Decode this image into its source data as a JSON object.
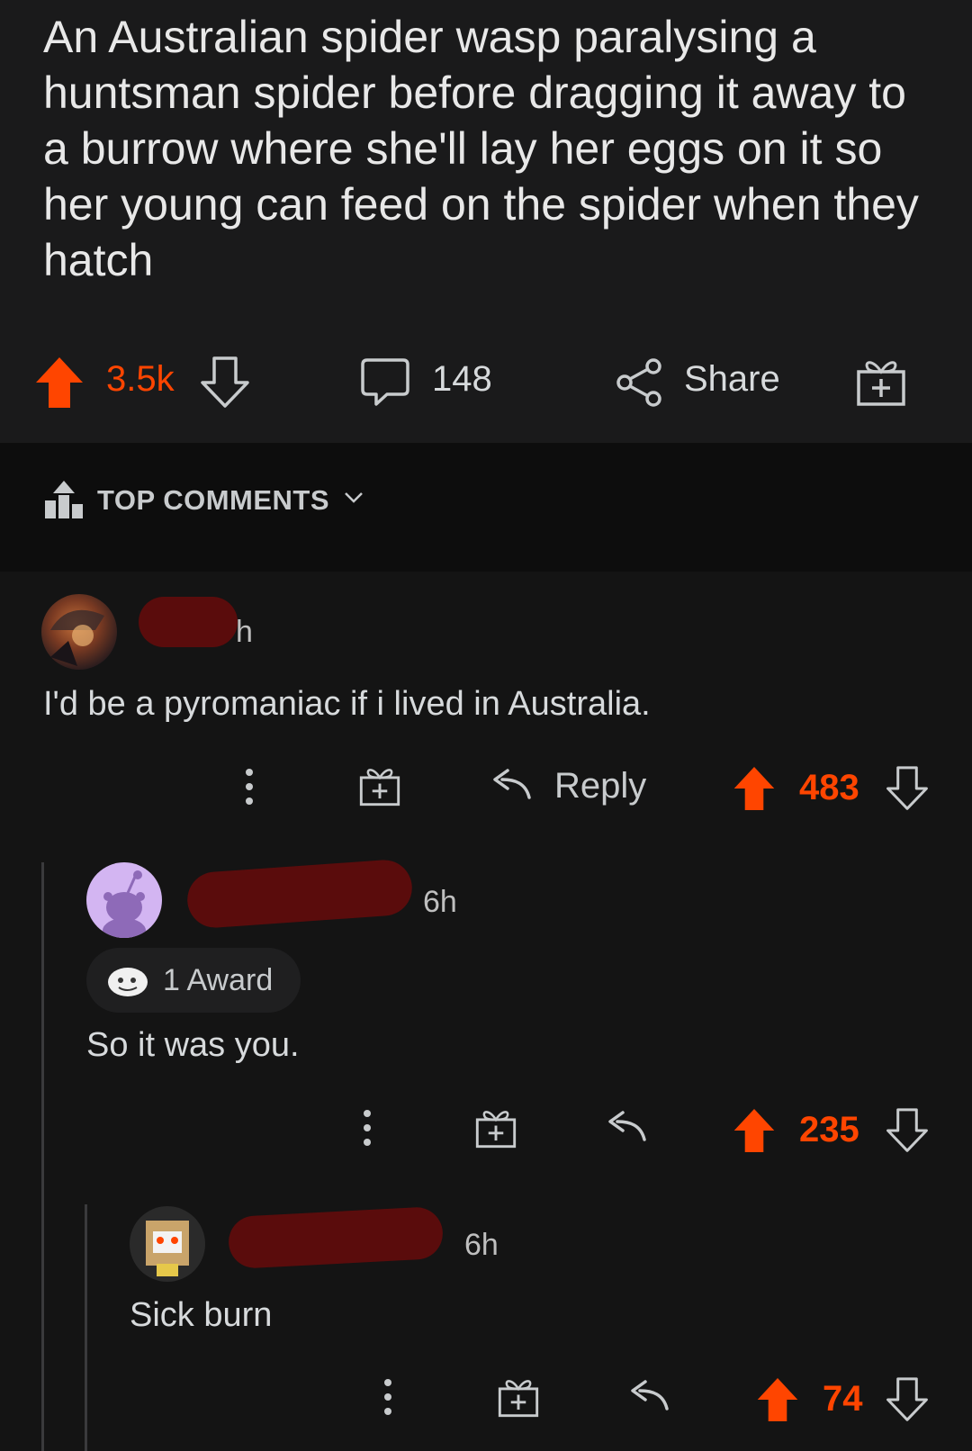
{
  "post": {
    "title": "An Australian spider wasp paralysing a huntsman spider before dragging it away to a burrow where she'll lay her eggs on it so her young can feed on the spider when they hatch",
    "score": "3.5k",
    "comment_count": "148",
    "share_label": "Share"
  },
  "comments_header": {
    "sort_label": "TOP COMMENTS"
  },
  "comments": [
    {
      "age": "h",
      "body": "I'd be a pyromaniac if i lived in Australia.",
      "reply_label": "Reply",
      "score": "483"
    },
    {
      "age": "6h",
      "award": "1 Award",
      "body": "So it was you.",
      "score": "235"
    },
    {
      "age": "6h",
      "body": "Sick burn",
      "score": "74"
    }
  ],
  "colors": {
    "accent": "#ff4500",
    "background": "#141414",
    "redaction": "#5a0c0c"
  }
}
